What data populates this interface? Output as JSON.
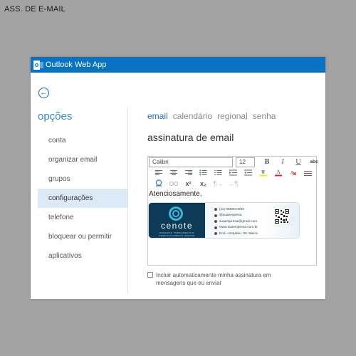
{
  "page_label": "ASS. DE E-MAIL",
  "window": {
    "title": "Outlook Web App"
  },
  "sidebar": {
    "title": "opções",
    "items": [
      {
        "label": "conta"
      },
      {
        "label": "organizar email"
      },
      {
        "label": "grupos"
      },
      {
        "label": "configurações",
        "selected": true
      },
      {
        "label": "telefone"
      },
      {
        "label": "bloquear ou permitir"
      },
      {
        "label": "aplicativos"
      }
    ]
  },
  "tabs": [
    {
      "label": "email",
      "active": true
    },
    {
      "label": "calendário"
    },
    {
      "label": "regional"
    },
    {
      "label": "senha"
    }
  ],
  "heading": "assinatura de email",
  "editor": {
    "font": "Calibri",
    "size": "12",
    "format_buttons": {
      "bold": "B",
      "italic": "I",
      "underline": "U",
      "strike": "abc"
    },
    "superscript": "x²",
    "subscript": "x₂",
    "spell": "abc",
    "signature_text": "Atenciosamente,"
  },
  "signature_card": {
    "brand": "cenote",
    "brand_sub": "PESQUISA, TREINAMENTO E DESENVOLVIMENTO HUMANO",
    "contacts": [
      "(xx) 00000-0000",
      "@suaempresa",
      "suaempresa@gmail.com",
      "www.suaempresa.com.br",
      "End. completo, 00, Bairro"
    ]
  },
  "checkbox": {
    "label": "Incluir automaticamente minha assinatura em mensagens que eu enviar",
    "checked": false
  },
  "colors": {
    "titlebar": "#0a72c4",
    "accent": "#2773b8",
    "selected_bg": "#dce9f6",
    "card_dark": "#0d3a57"
  }
}
